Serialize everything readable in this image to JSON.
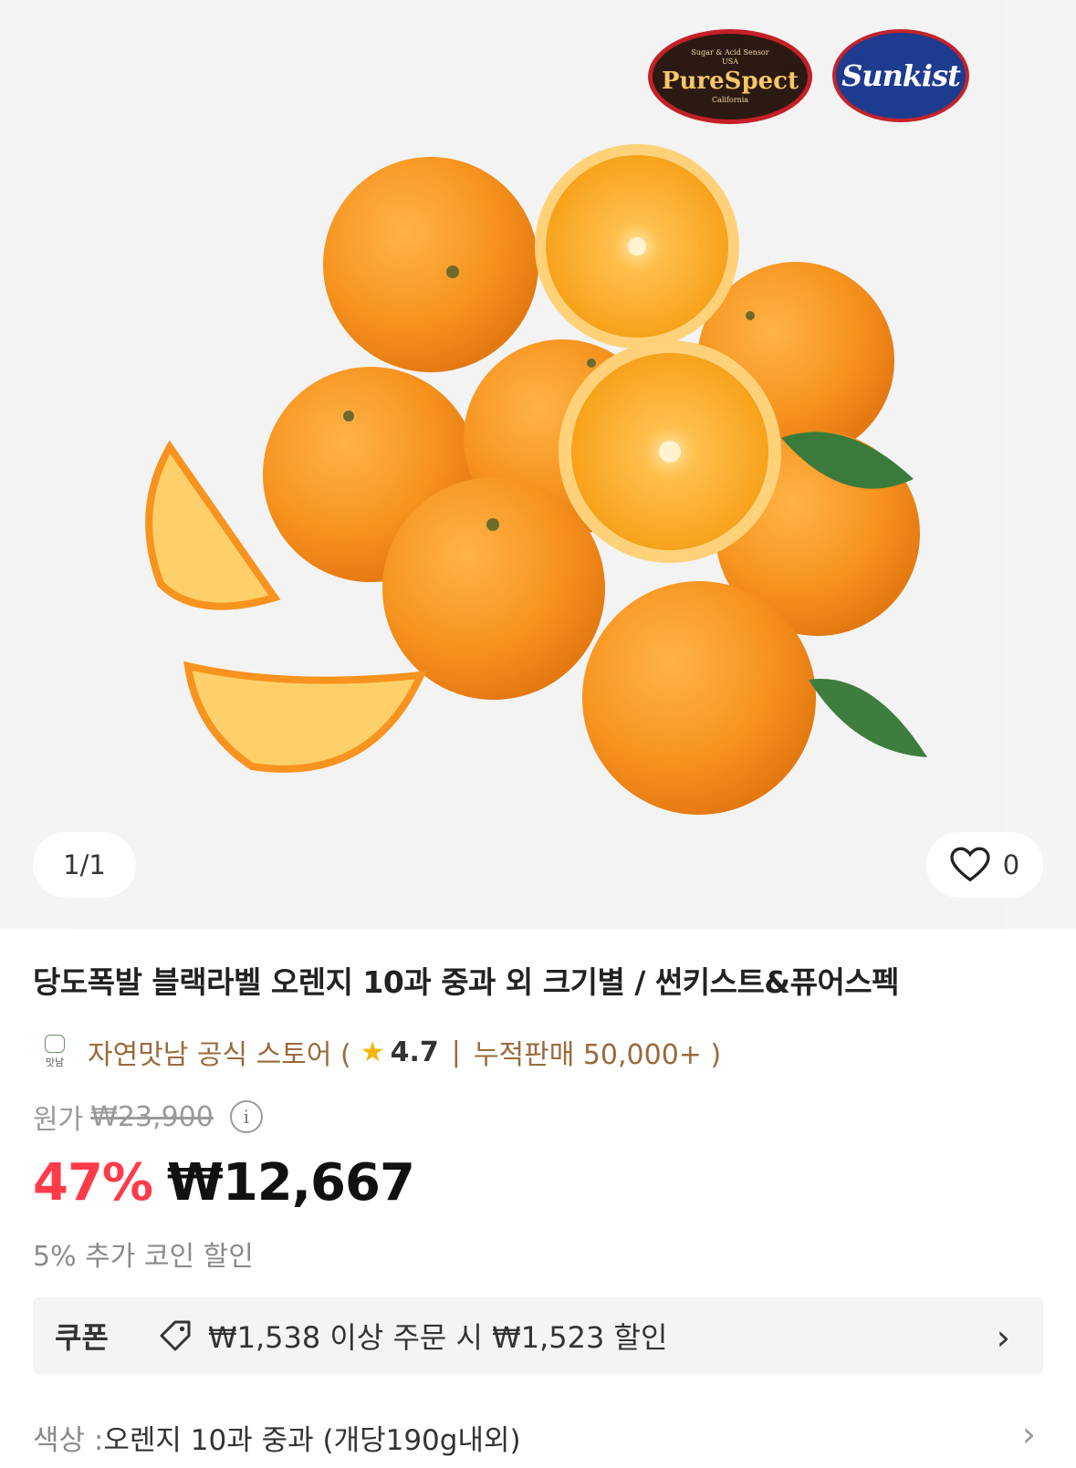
{
  "gallery": {
    "counter": "1/1",
    "like_count": "0",
    "badges": {
      "pure_spect_top": "Sugar & Acid Sensor",
      "pure_spect_usa": "USA",
      "pure_spect_name": "PureSpect",
      "pure_spect_bottom": "California",
      "sunkist": "Sunkist"
    }
  },
  "product": {
    "title": "당도폭발 블랙라벨 오렌지 10과 중과 외 크기별 / 썬키스트&퓨어스펙"
  },
  "store": {
    "logo_text": "맛남",
    "name": "자연맛남 공식 스토어 (",
    "rating": "4.7",
    "separator": "|",
    "sales": "누적판매 50,000+ )"
  },
  "pricing": {
    "original_label": "원가",
    "original_price": "₩23,900",
    "discount_percent": "47%",
    "current_price": "₩12,667",
    "coin_note": "5% 추가 코인 할인"
  },
  "coupon": {
    "label": "쿠폰",
    "description": "₩1,538 이상 주문 시 ₩1,523 할인"
  },
  "option": {
    "key": "색상 : ",
    "value": "오렌지 10과 중과 (개당190g내외)"
  },
  "colors": {
    "discount": "#ff3b4a",
    "store": "#9a6a3a",
    "orange": "#f7931e"
  }
}
